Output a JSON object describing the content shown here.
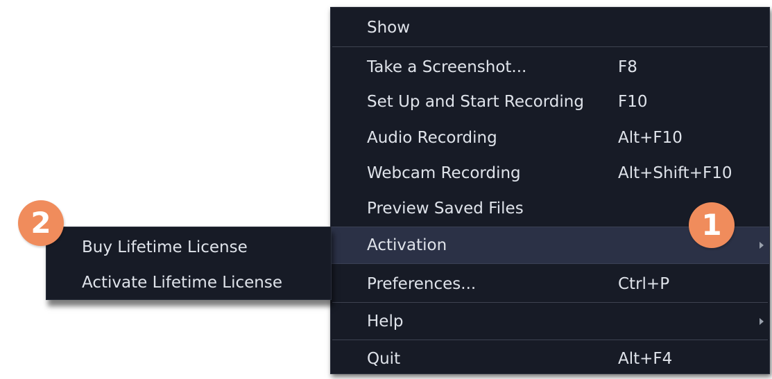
{
  "main_menu": {
    "items": [
      {
        "label": "Show",
        "shortcut": ""
      },
      {
        "label": "Take a Screenshot...",
        "shortcut": "F8"
      },
      {
        "label": "Set Up and Start Recording",
        "shortcut": "F10"
      },
      {
        "label": "Audio Recording",
        "shortcut": "Alt+F10"
      },
      {
        "label": "Webcam Recording",
        "shortcut": "Alt+Shift+F10"
      },
      {
        "label": "Preview Saved Files",
        "shortcut": ""
      },
      {
        "label": "Activation",
        "shortcut": "",
        "has_submenu": true,
        "highlighted": true
      },
      {
        "label": "Preferences...",
        "shortcut": "Ctrl+P"
      },
      {
        "label": "Help",
        "shortcut": "",
        "has_submenu": true
      },
      {
        "label": "Quit",
        "shortcut": "Alt+F4"
      }
    ]
  },
  "submenu": {
    "parent": "Activation",
    "items": [
      {
        "label": "Buy Lifetime License"
      },
      {
        "label": "Activate Lifetime License"
      }
    ]
  },
  "callouts": {
    "step1": "1",
    "step2": "2"
  },
  "colors": {
    "menu_background": "#171b26",
    "highlight_background": "#2b3146",
    "text": "#dfe3ea",
    "separator": "#3e4351",
    "callout": "#f08c5c"
  },
  "icons": {
    "submenu_arrow": "chevron-right-icon"
  }
}
